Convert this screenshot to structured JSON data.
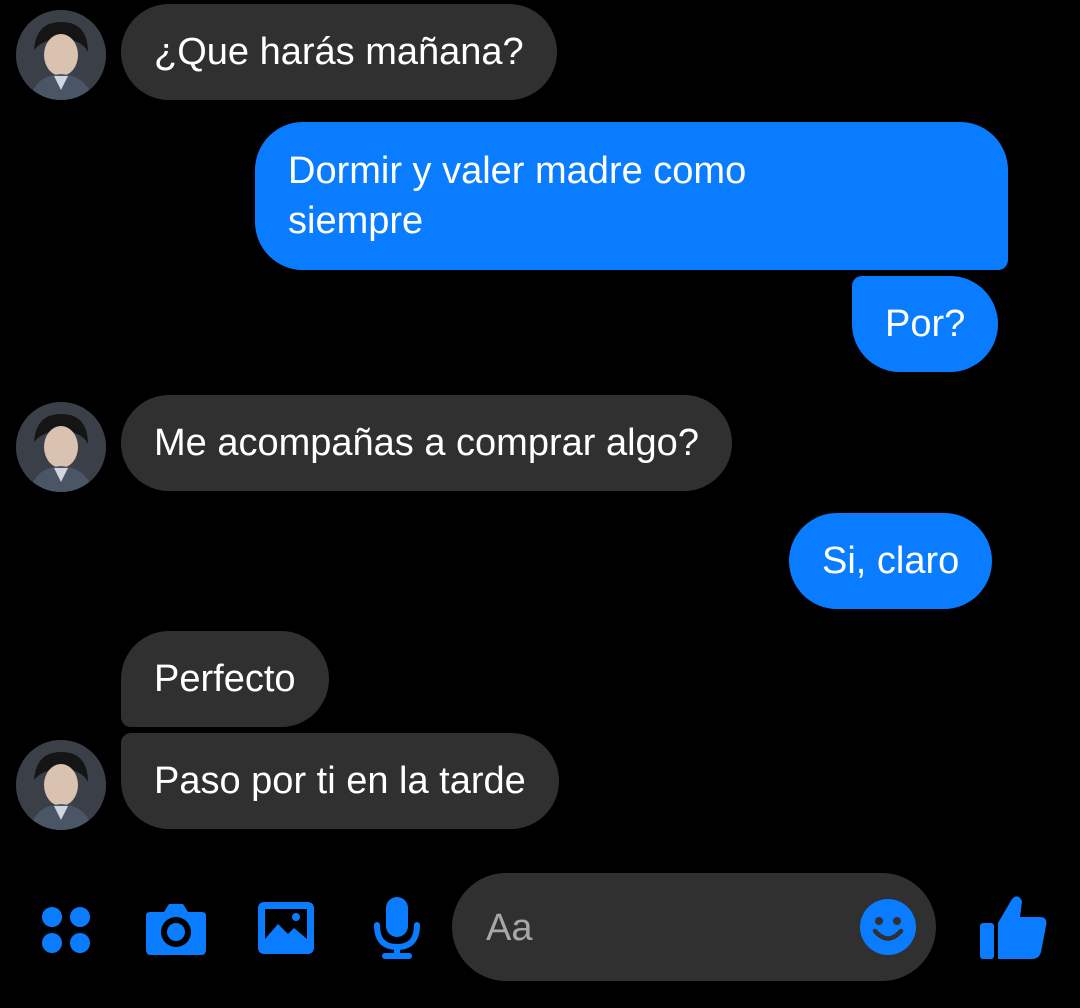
{
  "accent_color": "#0a7cff",
  "incoming_bubble_color": "#303030",
  "messages": [
    {
      "sender": "them",
      "text": "¿Que harás mañana?"
    },
    {
      "sender": "me",
      "text": "Dormir y valer madre como siempre"
    },
    {
      "sender": "me",
      "text": "Por?"
    },
    {
      "sender": "them",
      "text": "Me acompañas a comprar algo?"
    },
    {
      "sender": "me",
      "text": "Si, claro"
    },
    {
      "sender": "them",
      "text": "Perfecto"
    },
    {
      "sender": "them",
      "text": "Paso por ti en la tarde"
    }
  ],
  "composer": {
    "placeholder": "Aa",
    "icons": [
      "apps-grid-icon",
      "camera-icon",
      "gallery-icon",
      "microphone-icon",
      "emoji-icon",
      "thumbs-up-icon"
    ]
  }
}
